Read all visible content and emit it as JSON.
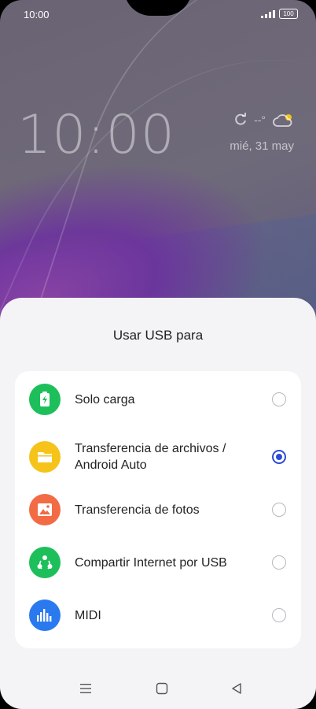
{
  "status_bar": {
    "time": "10:00",
    "battery": "100",
    "icons": [
      "signal-icon",
      "battery-icon"
    ]
  },
  "lockscreen": {
    "clock": "10:00",
    "weather_temp": "--°",
    "date": "mié, 31 may",
    "icons": [
      "refresh-icon",
      "cloud-sun-icon"
    ]
  },
  "sheet": {
    "title": "Usar USB para",
    "accent": "#2e4bd6",
    "options": [
      {
        "label": "Solo carga",
        "icon": "battery-charging-icon",
        "color": "#1dbf5a",
        "selected": false
      },
      {
        "label": "Transferencia de archivos / Android Auto",
        "icon": "folder-icon",
        "color": "#f6c31a",
        "selected": true
      },
      {
        "label": "Transferencia de fotos",
        "icon": "image-icon",
        "color": "#f26b45",
        "selected": false
      },
      {
        "label": "Compartir Internet por USB",
        "icon": "share-network-icon",
        "color": "#1dbf5a",
        "selected": false
      },
      {
        "label": "MIDI",
        "icon": "equalizer-icon",
        "color": "#2a79ef",
        "selected": false
      }
    ]
  },
  "nav_bar": {
    "buttons": [
      "menu-icon",
      "home-icon",
      "back-icon"
    ]
  }
}
